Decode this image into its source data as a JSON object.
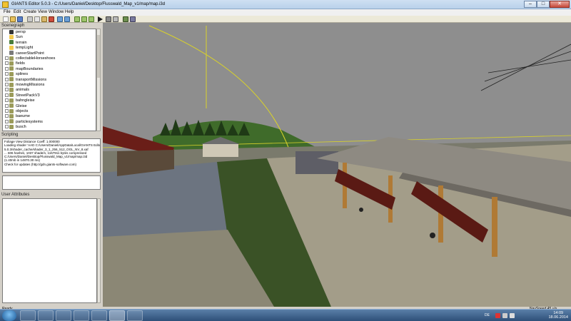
{
  "window": {
    "title": "GIANTS Editor 5.0.3 - C:/Users/Daniel/Desktop/Flusswald_Map_v1/map/map.i3d",
    "min_label": "–",
    "max_label": "□",
    "close_label": "✕"
  },
  "menu": [
    "File",
    "Edit",
    "Create",
    "View",
    "Window",
    "Help"
  ],
  "toolbar_icons": [
    "new-icon",
    "open-icon",
    "save-icon",
    "cut-icon",
    "copy-icon",
    "paste-icon",
    "delete-icon",
    "undo-icon",
    "redo-icon",
    "move-icon",
    "rotate-icon",
    "scale-icon",
    "play-icon",
    "camera-icon",
    "grid-icon",
    "terrain-icon",
    "tools-icon"
  ],
  "scenegraph": {
    "header": "Scenegraph",
    "items": [
      {
        "label": "persp",
        "expandable": false,
        "icon": "camera-icon",
        "color": "#333333"
      },
      {
        "label": "Sun",
        "expandable": false,
        "icon": "light-icon",
        "color": "#f2c94c"
      },
      {
        "label": "terrain",
        "expandable": false,
        "icon": "terrain-icon",
        "color": "#4a7d3a"
      },
      {
        "label": "tempLight",
        "expandable": false,
        "icon": "light-icon",
        "color": "#f2c94c"
      },
      {
        "label": "careerStartPoint",
        "expandable": false,
        "icon": "transform-icon",
        "color": "#7a7a7a"
      },
      {
        "label": "collectableHorseshoes",
        "expandable": true,
        "icon": "group-icon",
        "color": "#9b9b5a"
      },
      {
        "label": "fields",
        "expandable": true,
        "icon": "group-icon",
        "color": "#9b9b5a"
      },
      {
        "label": "mapBoundaries",
        "expandable": true,
        "icon": "group-icon",
        "color": "#9b9b5a"
      },
      {
        "label": "splines",
        "expandable": true,
        "icon": "group-icon",
        "color": "#9b9b5a"
      },
      {
        "label": "transportMissions",
        "expandable": true,
        "icon": "group-icon",
        "color": "#9b9b5a"
      },
      {
        "label": "mowingMissions",
        "expandable": true,
        "icon": "group-icon",
        "color": "#9b9b5a"
      },
      {
        "label": "animals",
        "expandable": true,
        "icon": "group-icon",
        "color": "#9b9b5a"
      },
      {
        "label": "StreetPackV3",
        "expandable": true,
        "icon": "group-icon",
        "color": "#9b9b5a"
      },
      {
        "label": "bahngleise",
        "expandable": true,
        "icon": "group-icon",
        "color": "#9b9b5a"
      },
      {
        "label": "Gleise",
        "expandable": true,
        "icon": "group-icon",
        "color": "#9b9b5a"
      },
      {
        "label": "objects",
        "expandable": true,
        "icon": "group-icon",
        "color": "#9b9b5a"
      },
      {
        "label": "baeume",
        "expandable": true,
        "icon": "group-icon",
        "color": "#9b9b5a"
      },
      {
        "label": "particlesystems",
        "expandable": true,
        "icon": "group-icon",
        "color": "#9b9b5a"
      },
      {
        "label": "busch",
        "expandable": true,
        "icon": "group-icon",
        "color": "#9b9b5a"
      }
    ]
  },
  "scripting": {
    "header": "Scripting",
    "log": [
      "Foliage View Distance Coeff: 1.000000",
      "Loading shader 'AAD C:/Users/Daniel/AppData/Local/GIANTS Editor",
      "5.0.3/shader_cache/shader_3_1_256_512_OGL_NV_8.xaf",
      "... 606 hashes, 1037 shaders, 1167911 bytes compressed",
      "C:/Users/Daniel/Desktop/Flusswald_Map_v1/map/map.i3d",
      "(1.40mb in 14870.30 ms)",
      "Check for updates (http://gdn.giants-software.com)"
    ]
  },
  "attributes": {
    "header": "User Attributes"
  },
  "statusbar": {
    "left": "Ready",
    "right": "NavSpeed 45 u/s"
  },
  "taskbar": {
    "apps": [
      "explorer-icon",
      "media-player-icon",
      "checkmark-icon",
      "internet-explorer-icon",
      "chrome-icon",
      "folder-icon",
      "giants-editor-icon"
    ],
    "active_index": 5,
    "language": "DE",
    "time": "14:09",
    "date": "18.06.2014"
  }
}
